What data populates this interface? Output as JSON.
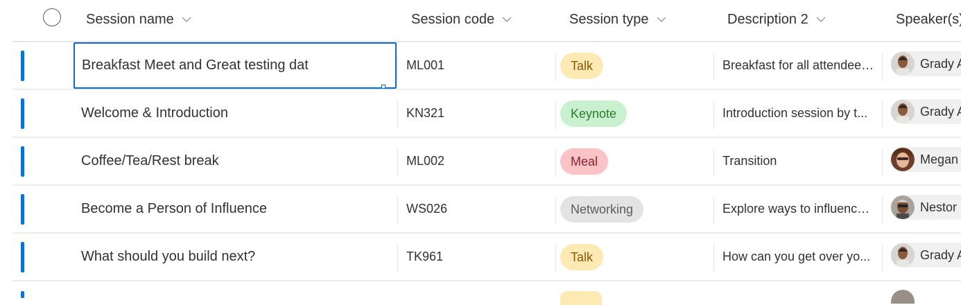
{
  "columns": {
    "session_name": "Session name",
    "session_code": "Session code",
    "session_type": "Session type",
    "description": "Description 2",
    "speakers": "Speaker(s)"
  },
  "rows": [
    {
      "name": "Breakfast Meet and Great testing dat",
      "code": "ML001",
      "type": "Talk",
      "description": "Breakfast for all attendees...",
      "speaker": "Grady A"
    },
    {
      "name": "Welcome & Introduction",
      "code": "KN321",
      "type": "Keynote",
      "description": "Introduction session by t...",
      "speaker": "Grady A"
    },
    {
      "name": "Coffee/Tea/Rest break",
      "code": "ML002",
      "type": "Meal",
      "description": "Transition",
      "speaker": "Megan"
    },
    {
      "name": "Become a Person of Influence",
      "code": "WS026",
      "type": "Networking",
      "description": "Explore ways to influence ...",
      "speaker": "Nestor"
    },
    {
      "name": "What should you build next?",
      "code": "TK961",
      "type": "Talk",
      "description": "How can you get over yo...",
      "speaker": "Grady A"
    }
  ],
  "colors": {
    "accent": "#0a74d6",
    "talk_bg": "#fde9b3",
    "keynote_bg": "#caf1cf",
    "meal_bg": "#f9c3c8",
    "networking_bg": "#e3e3e3"
  },
  "icons": {
    "select_all": "circle-checkbox-icon",
    "sort": "chevron-down-icon",
    "avatar": "person-avatar-icon"
  }
}
